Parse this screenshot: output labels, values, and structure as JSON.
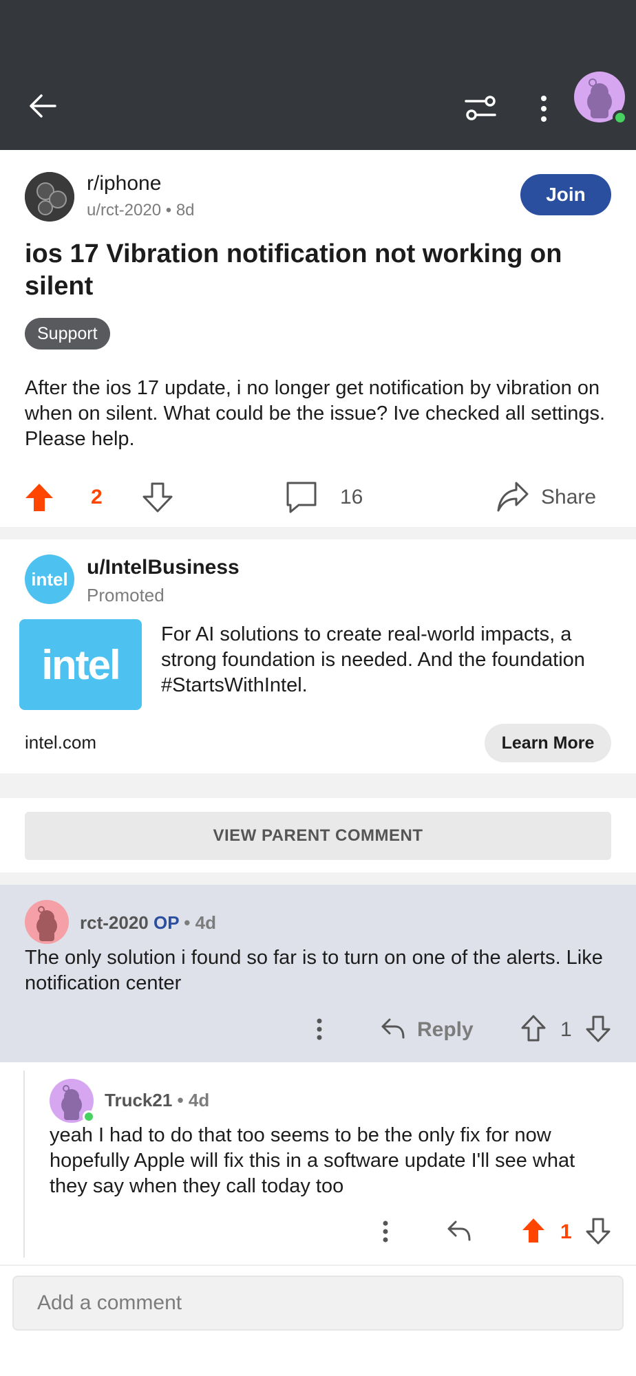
{
  "post": {
    "subreddit": "r/iphone",
    "author": "u/rct-2020",
    "age": "8d",
    "join_label": "Join",
    "title": "ios 17 Vibration notification not working on silent",
    "flair": "Support",
    "body": "After the ios 17 update, i no longer get notification by vibration on when on silent. What could be the issue? Ive checked all settings. Please help.",
    "votes": "2",
    "comments": "16",
    "share_label": "Share"
  },
  "ad": {
    "user": "u/IntelBusiness",
    "promoted": "Promoted",
    "avatar_text": "intel",
    "image_text": "intel",
    "text": "For AI solutions to create real-world impacts, a strong foundation is needed. And the foundation #StartsWithIntel.",
    "domain": "intel.com",
    "cta": "Learn More"
  },
  "view_parent_label": "VIEW PARENT COMMENT",
  "comments": [
    {
      "user": "rct-2020",
      "op_label": "OP",
      "age": "4d",
      "body": "The only solution i found so far is to turn on one of the alerts. Like notification center",
      "reply_label": "Reply",
      "votes": "1"
    },
    {
      "user": "Truck21",
      "age": "4d",
      "body": "yeah I had to do that too seems to be the only fix for now hopefully Apple will fix this in a software update I'll see what they say when they call today too",
      "votes": "1"
    }
  ],
  "add_comment_placeholder": "Add a comment",
  "colors": {
    "topbar": "#34373c",
    "accent_upvote": "#ff4500",
    "join": "#2a4f9e",
    "highlight": "#dfe1ea"
  }
}
